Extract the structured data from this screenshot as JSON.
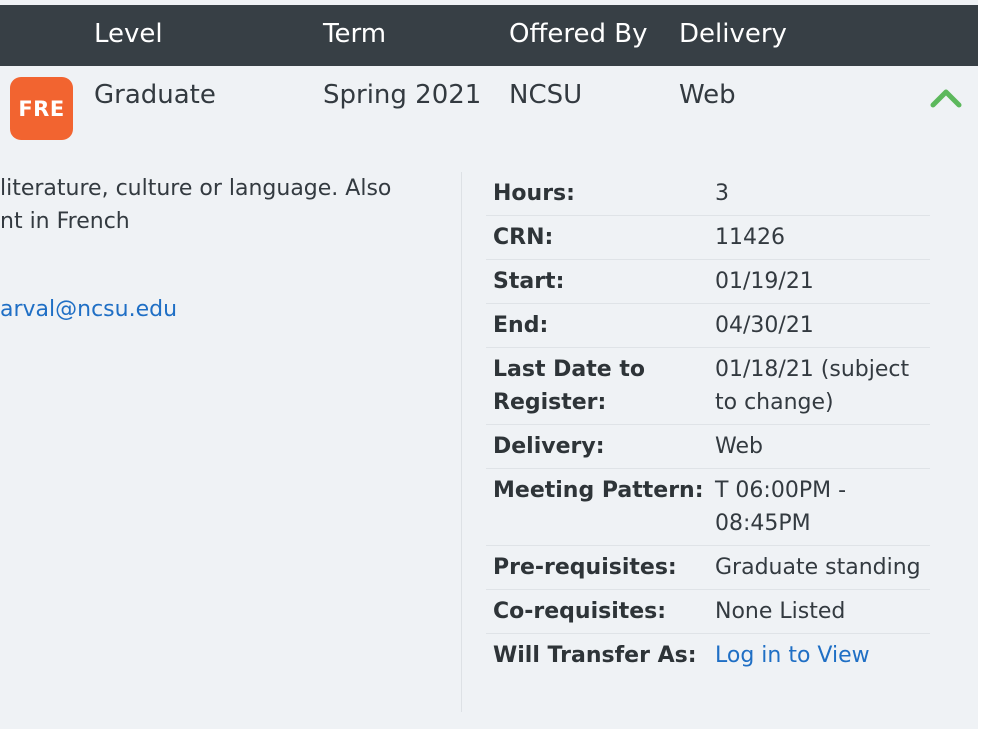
{
  "header": {
    "level": "Level",
    "term": "Term",
    "offered_by": "Offered By",
    "delivery": "Delivery"
  },
  "course": {
    "badge": "FRE",
    "level": "Graduate",
    "term": "Spring 2021",
    "offered_by": "NCSU",
    "delivery": "Web"
  },
  "description": {
    "lines": [
      "literature, culture or language. Also",
      "nt in French"
    ],
    "email": "arval@ncsu.edu"
  },
  "details": [
    {
      "label": "Hours:",
      "value": "3"
    },
    {
      "label": "CRN:",
      "value": "11426"
    },
    {
      "label": "Start:",
      "value": "01/19/21"
    },
    {
      "label": "End:",
      "value": "04/30/21"
    },
    {
      "label": "Last Date to Register:",
      "value": "01/18/21 (subject to change)"
    },
    {
      "label": "Delivery:",
      "value": "Web"
    },
    {
      "label": "Meeting Pattern:",
      "value": "T 06:00PM - 08:45PM"
    },
    {
      "label": "Pre-requisites:",
      "value": "Graduate standing"
    },
    {
      "label": "Co-requisites:",
      "value": "None Listed"
    },
    {
      "label": "Will Transfer As:",
      "value": "Log in to View"
    }
  ],
  "colors": {
    "header_bg": "#373f45",
    "badge_bg": "#f26430",
    "link": "#1f6fc5",
    "chevron": "#5cb85c",
    "page_bg": "#eff2f5"
  }
}
